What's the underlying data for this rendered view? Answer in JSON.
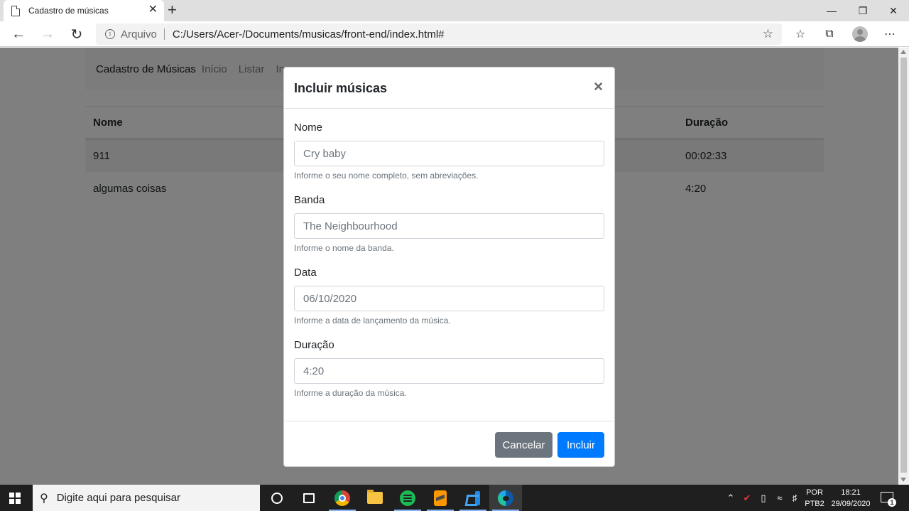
{
  "browser": {
    "tab_title": "Cadastro de músicas",
    "tab_close": "✕",
    "new_tab": "+",
    "address_label": "Arquivo",
    "url": "C:/Users/Acer-/Documents/musicas/front-end/index.html#",
    "window_controls": {
      "minimize": "—",
      "restore": "❐",
      "close": "✕"
    }
  },
  "navbar": {
    "brand": "Cadastro de Músicas",
    "links": [
      "Início",
      "Listar",
      "Inc"
    ]
  },
  "table": {
    "headers": [
      "Nome",
      "Duração"
    ],
    "rows": [
      {
        "nome": "911",
        "duracao": "00:02:33"
      },
      {
        "nome": "algumas coisas",
        "duracao": "4:20"
      }
    ]
  },
  "modal": {
    "title": "Incluir músicas",
    "close": "×",
    "fields": [
      {
        "label": "Nome",
        "value": "Cry baby",
        "help": "Informe o seu nome completo, sem abreviações."
      },
      {
        "label": "Banda",
        "value": "The Neighbourhood",
        "help": "Informe o nome da banda."
      },
      {
        "label": "Data",
        "value": "06/10/2020",
        "help": "Informe a data de lançamento da música."
      },
      {
        "label": "Duração",
        "value": "4:20",
        "help": "Informe a duração da música."
      }
    ],
    "cancel_label": "Cancelar",
    "submit_label": "Incluir"
  },
  "taskbar": {
    "search_placeholder": "Digite aqui para pesquisar",
    "lang_top": "POR",
    "lang_bottom": "PTB2",
    "time": "18:21",
    "date": "29/09/2020",
    "notification_count": "1"
  },
  "colors": {
    "primary": "#007bff",
    "secondary": "#6c757d",
    "backdrop": "rgba(0,0,0,0.5)"
  }
}
